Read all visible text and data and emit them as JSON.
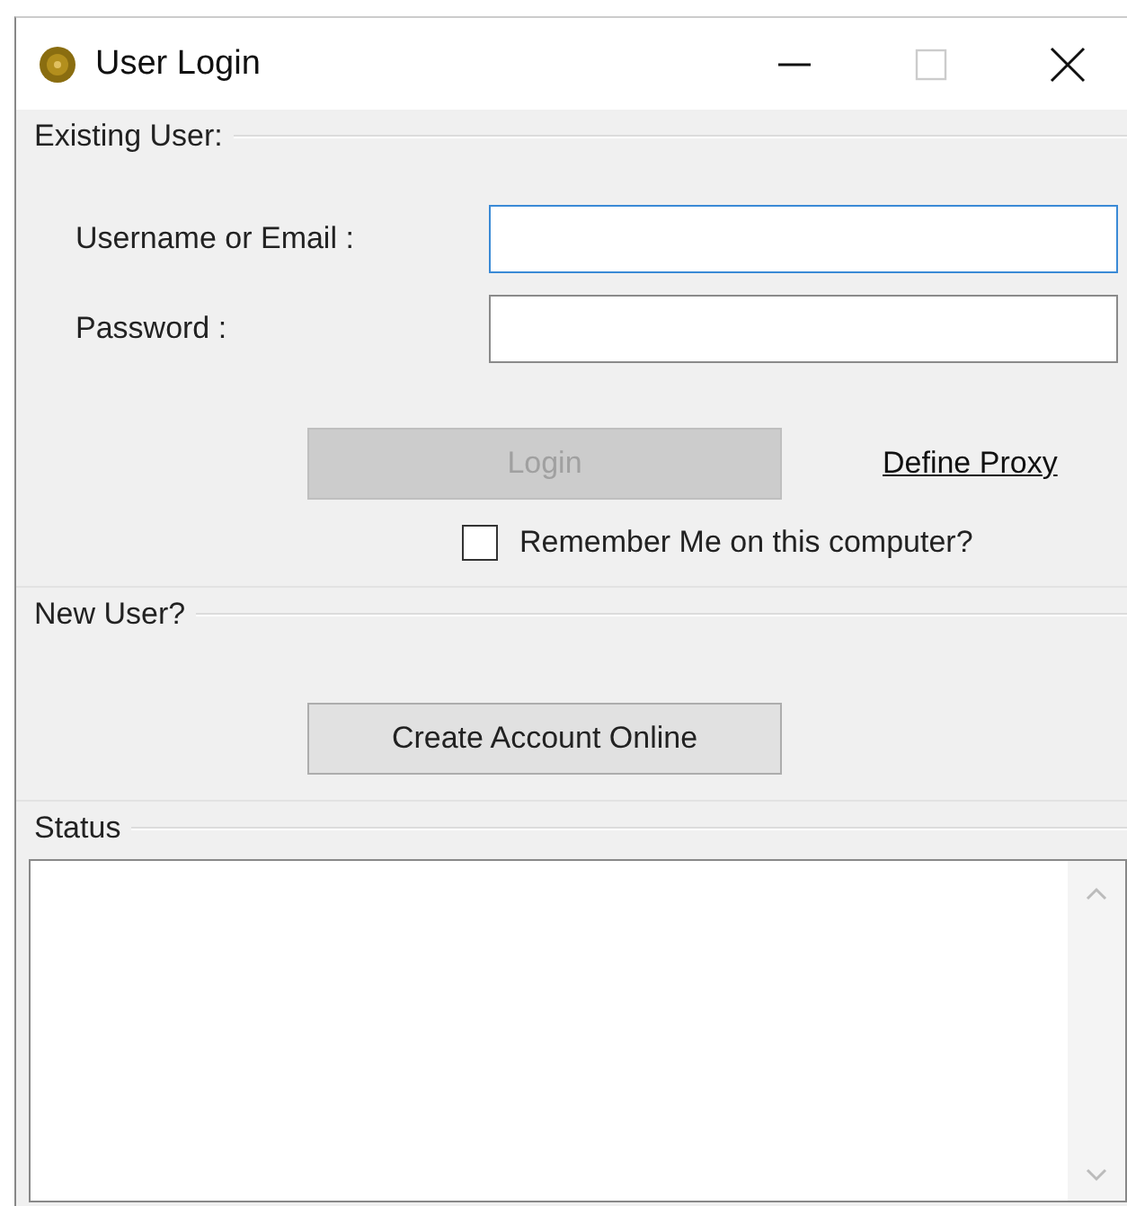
{
  "window": {
    "title": "User Login"
  },
  "existing_user": {
    "title": "Existing User:",
    "fields": [
      {
        "label": "Username or Email :",
        "focused": true
      },
      {
        "label": "Password :",
        "focused": false
      }
    ],
    "login_button": {
      "label": "Login",
      "disabled": true
    },
    "proxy_link": "Define Proxy",
    "remember": {
      "label": "Remember Me on this computer?",
      "checked": false
    }
  },
  "new_user": {
    "title": "New User?",
    "button": "Create Account Online"
  },
  "status": {
    "title": "Status"
  }
}
